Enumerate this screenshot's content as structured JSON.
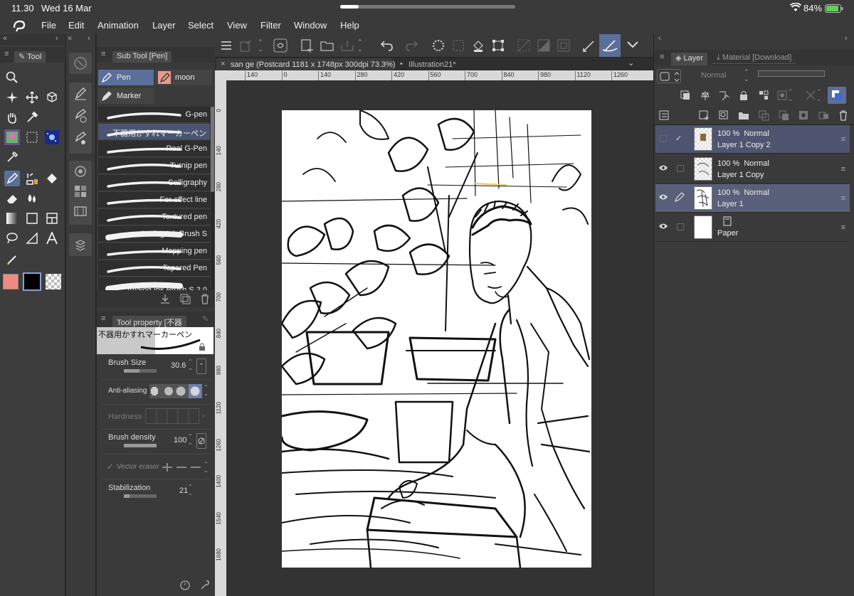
{
  "status": {
    "time": "11.30",
    "date": "Wed 16 Mar",
    "battery": "84%"
  },
  "menu": [
    "File",
    "Edit",
    "Animation",
    "Layer",
    "Select",
    "View",
    "Filter",
    "Window",
    "Help"
  ],
  "tool_panel": {
    "title": "Tool"
  },
  "sub_tool": {
    "title": "Sub Tool [Pen]",
    "tabs": [
      "Pen",
      "moon",
      "Marker"
    ],
    "brushes": [
      "G-pen",
      "不器用かすれマーカーペン",
      "Real G-Pen",
      "Turnip pen",
      "Calligraphy",
      "For effect line",
      "Textured pen",
      "Analog Ink Brush S",
      "Mapping pen",
      "Tapered Pen",
      "Analog Ink Brush S 2.0"
    ]
  },
  "tool_property": {
    "title": "Tool property [不器",
    "brush_name": "不器用かすれマーカーペン",
    "brush_size_label": "Brush Size",
    "brush_size_value": "30.6",
    "anti_aliasing_label": "Anti-aliasing",
    "hardness_label": "Hardness",
    "brush_density_label": "Brush density",
    "brush_density_value": "100",
    "vector_eraser_label": "Vector eraser",
    "stabilization_label": "Stabilization",
    "stabilization_value": "21"
  },
  "document": {
    "active_tab": "san ge (Postcard 1181 x 1748px 300dpi 73.3%)",
    "other_tab": "Illustration21*",
    "ruler_top": [
      "140",
      "0",
      "140",
      "280",
      "420",
      "560",
      "700",
      "840",
      "980",
      "1120",
      "1260"
    ],
    "ruler_left": [
      "0",
      "140",
      "280",
      "420",
      "560",
      "700",
      "840",
      "980",
      "1120",
      "1260",
      "1400",
      "1540",
      "1680"
    ]
  },
  "layer_panel": {
    "tab_layer": "Layer",
    "tab_material": "Material [Download]",
    "blend_mode": "Normal",
    "layers": [
      {
        "opacity": "100 %",
        "mode": "Normal",
        "name": "Layer 1 Copy 2"
      },
      {
        "opacity": "100 %",
        "mode": "Normal",
        "name": "Layer 1 Copy"
      },
      {
        "opacity": "100 %",
        "mode": "Normal",
        "name": "Layer 1"
      },
      {
        "opacity": "",
        "mode": "",
        "name": "Paper"
      }
    ]
  },
  "colors": {
    "main_color": "#f08a80",
    "sub_color": "#000000",
    "accent": "#5b6f9a"
  }
}
